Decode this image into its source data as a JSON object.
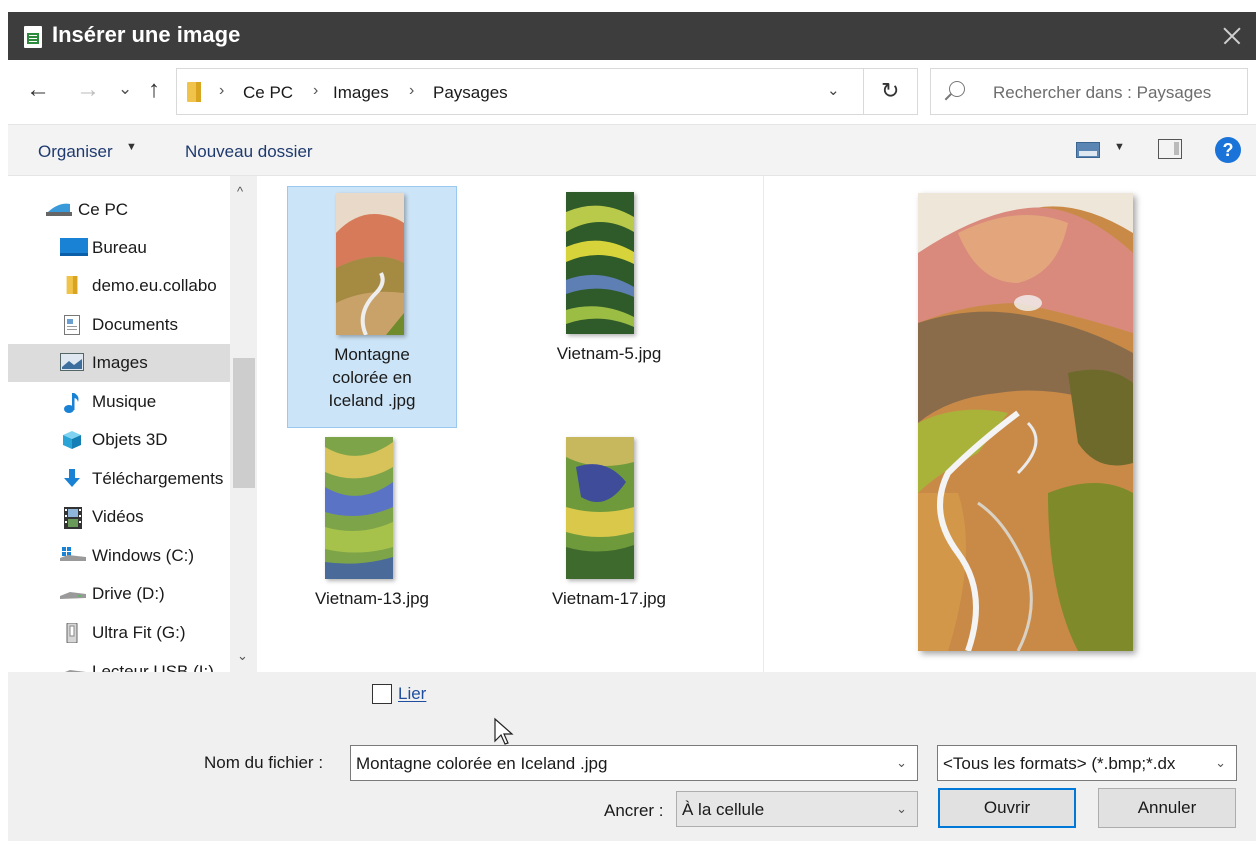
{
  "window": {
    "title": "Insérer une image"
  },
  "nav": {
    "back": "←",
    "forward": "→",
    "recent": "⌄",
    "up": "↑",
    "breadcrumb": [
      "Ce PC",
      "Images",
      "Paysages"
    ],
    "separator": "›",
    "refresh": "↻",
    "search_placeholder": "Rechercher dans : Paysages"
  },
  "toolbar": {
    "organize": "Organiser",
    "new_folder": "Nouveau dossier",
    "help": "?"
  },
  "sidebar": {
    "items": [
      {
        "label": "Ce PC",
        "icon": "computer-icon"
      },
      {
        "label": "Bureau",
        "icon": "desktop-icon"
      },
      {
        "label": "demo.eu.collabo",
        "icon": "folder-icon"
      },
      {
        "label": "Documents",
        "icon": "documents-icon"
      },
      {
        "label": "Images",
        "icon": "pictures-icon",
        "selected": true
      },
      {
        "label": "Musique",
        "icon": "music-icon"
      },
      {
        "label": "Objets 3D",
        "icon": "objects-3d-icon"
      },
      {
        "label": "Téléchargements",
        "icon": "downloads-icon"
      },
      {
        "label": "Vidéos",
        "icon": "videos-icon"
      },
      {
        "label": "Windows (C:)",
        "icon": "windows-drive-icon"
      },
      {
        "label": "Drive (D:)",
        "icon": "drive-icon"
      },
      {
        "label": "Ultra Fit (G:)",
        "icon": "usb-stick-icon"
      },
      {
        "label": "Lecteur USB (I:)",
        "icon": "usb-drive-icon"
      }
    ]
  },
  "files": [
    {
      "name_lines": [
        "Montagne",
        "colorée en",
        "Iceland .jpg"
      ],
      "selected": true
    },
    {
      "name_lines": [
        "Vietnam-5.jpg"
      ]
    },
    {
      "name_lines": [
        "Vietnam-13.jpg"
      ]
    },
    {
      "name_lines": [
        "Vietnam-17.jpg"
      ]
    }
  ],
  "footer": {
    "link_label": "Lier",
    "filename_label": "Nom du fichier :",
    "filename_value": "Montagne colorée en Iceland .jpg",
    "filter_value": "<Tous les formats> (*.bmp;*.dx",
    "anchor_label": "Ancrer :",
    "anchor_value": "À la cellule",
    "open_button": "Ouvrir",
    "cancel_button": "Annuler"
  },
  "colors": {
    "titlebar": "#3d3d3d",
    "selection": "#cce4f7",
    "accent": "#0078d7",
    "link": "#1f4e9e"
  }
}
